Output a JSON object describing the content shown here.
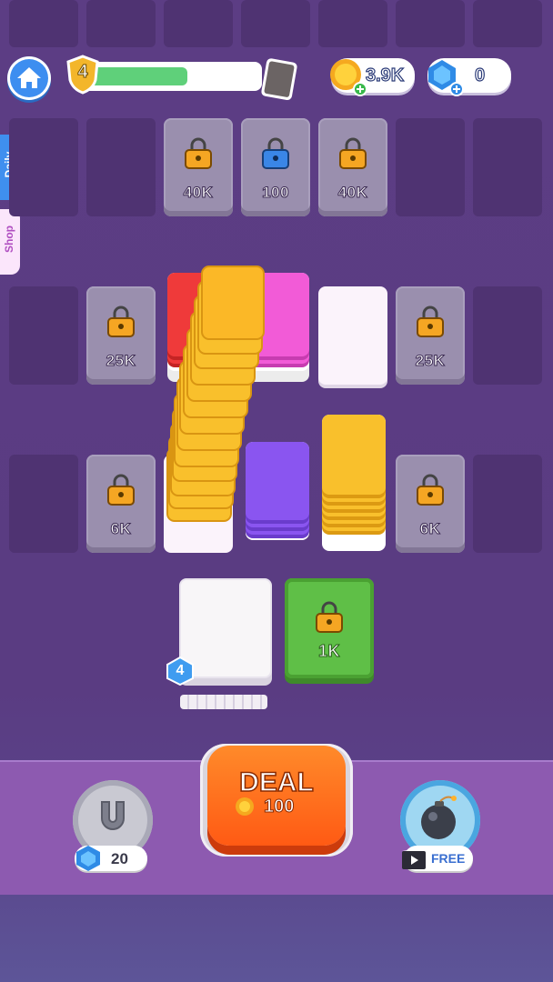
{
  "header": {
    "level": "4",
    "progress": 0.6,
    "coins": "3.9K",
    "gems": "0"
  },
  "side_tabs": {
    "daily": "Daily",
    "shop": "Shop"
  },
  "board": {
    "row1_prices": [
      "40K",
      "100",
      "40K"
    ],
    "row2_prices": [
      "25K",
      "25K"
    ],
    "row3_prices": [
      "6K",
      "6K"
    ],
    "unlock_slot_price": "1K",
    "hand_count": "4"
  },
  "deal_button": {
    "label": "DEAL",
    "cost": "100"
  },
  "boosters": {
    "magnet_cost": "20",
    "bomb_label": "FREE"
  },
  "colors": {
    "background": "#5c3d84",
    "yellow": "#f9c02c",
    "red": "#ef3a3a",
    "pink": "#f25bd7",
    "purple": "#8a55f0",
    "green": "#5fbf47",
    "deal_orange": "#ff6a1a"
  }
}
